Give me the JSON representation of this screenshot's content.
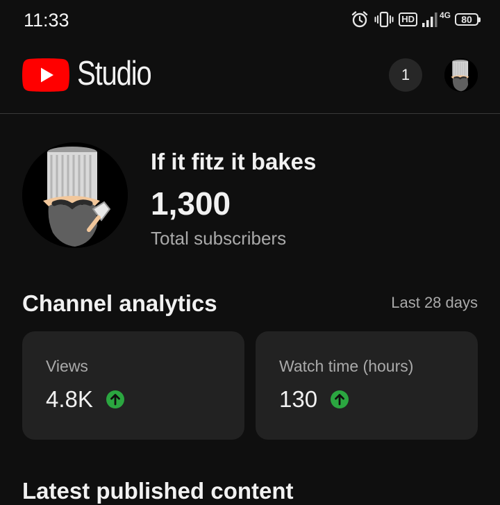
{
  "status_bar": {
    "time": "11:33",
    "icons": [
      "alarm-icon",
      "vibrate-icon",
      "hd-icon",
      "signal-icon",
      "4g-icon",
      "battery-icon"
    ],
    "hd_label": "HD",
    "network_label": "4G",
    "battery_level": "80"
  },
  "header": {
    "app_name": "Studio",
    "notification_count": "1"
  },
  "channel": {
    "name": "If it fitz it bakes",
    "subscriber_count": "1,300",
    "subscriber_label": "Total subscribers"
  },
  "analytics": {
    "title": "Channel analytics",
    "period": "Last 28 days",
    "cards": [
      {
        "label": "Views",
        "value": "4.8K",
        "trend": "up"
      },
      {
        "label": "Watch time (hours)",
        "value": "130",
        "trend": "up"
      }
    ]
  },
  "latest": {
    "title": "Latest published content"
  },
  "colors": {
    "background": "#0f0f0f",
    "card": "#222222",
    "youtube_red": "#ff0000",
    "trend_up_green": "#2ba640",
    "secondary_text": "#aaaaaa"
  }
}
